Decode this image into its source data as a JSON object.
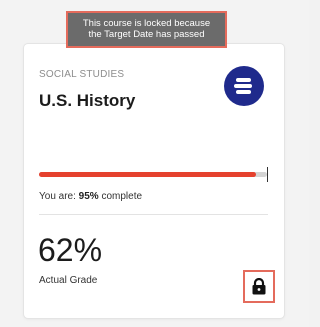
{
  "tooltip": {
    "line1": "This course is locked because",
    "line2": "the Target Date has passed"
  },
  "course": {
    "subject": "SOCIAL STUDIES",
    "title": "U.S. History",
    "logo_icon": "edmentum-logo-icon"
  },
  "progress": {
    "prefix": "You are:",
    "value": "95%",
    "suffix": "complete",
    "fraction": 0.95
  },
  "grade": {
    "value": "62%",
    "label": "Actual Grade"
  },
  "lock": {
    "icon": "lock-icon"
  },
  "colors": {
    "accent": "#e5412e",
    "logo": "#1f2a8c",
    "highlight": "#e46b5c"
  }
}
